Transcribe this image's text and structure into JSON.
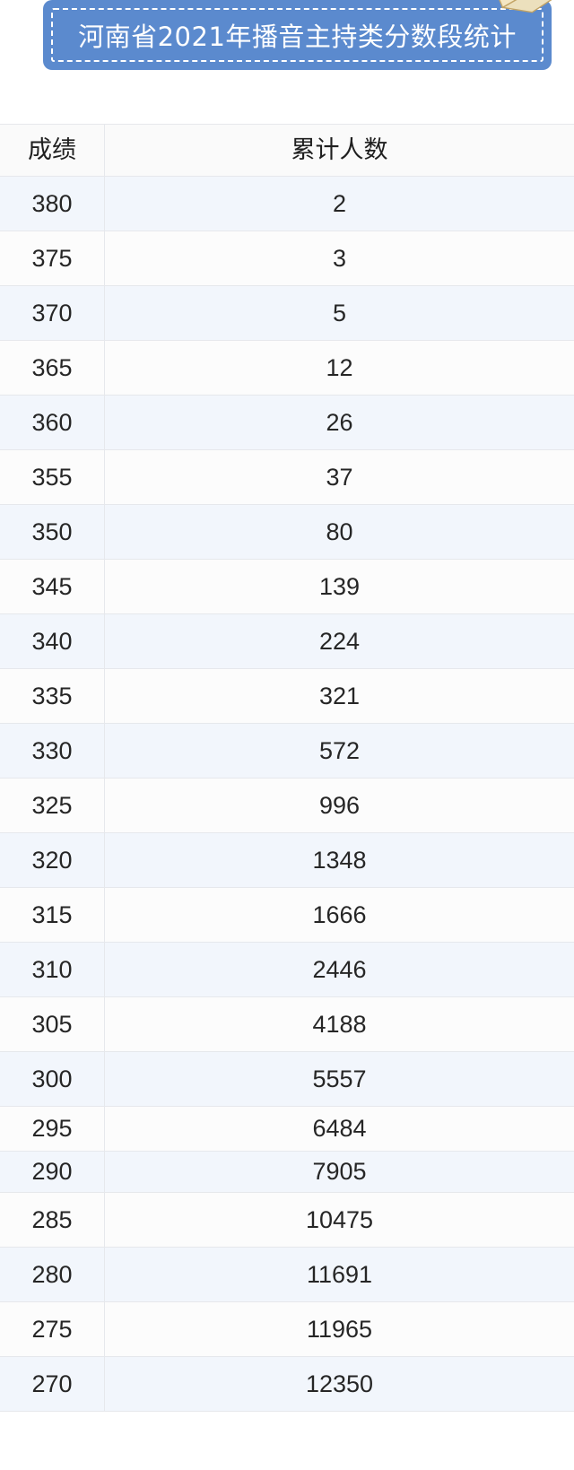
{
  "banner": {
    "title": "河南省2021年播音主持类分数段统计",
    "background_color": "#5b8ace",
    "text_color": "#ffffff",
    "border_style": "white-dashed",
    "decoration_icon": "open-book-icon"
  },
  "table": {
    "columns": [
      "成绩",
      "累计人数"
    ],
    "row_colors": {
      "odd": "#f2f6fc",
      "even": "#fcfcfc",
      "header": "#fafafa",
      "border": "#e6e8ec"
    },
    "rows": [
      {
        "score": "380",
        "count": "2"
      },
      {
        "score": "375",
        "count": "3"
      },
      {
        "score": "370",
        "count": "5"
      },
      {
        "score": "365",
        "count": "12"
      },
      {
        "score": "360",
        "count": "26"
      },
      {
        "score": "355",
        "count": "37"
      },
      {
        "score": "350",
        "count": "80"
      },
      {
        "score": "345",
        "count": "139"
      },
      {
        "score": "340",
        "count": "224"
      },
      {
        "score": "335",
        "count": "321"
      },
      {
        "score": "330",
        "count": "572"
      },
      {
        "score": "325",
        "count": "996"
      },
      {
        "score": "320",
        "count": "1348"
      },
      {
        "score": "315",
        "count": "1666"
      },
      {
        "score": "310",
        "count": "2446"
      },
      {
        "score": "305",
        "count": "4188"
      },
      {
        "score": "300",
        "count": "5557"
      },
      {
        "score": "295",
        "count": "6484"
      },
      {
        "score": "290",
        "count": "7905"
      },
      {
        "score": "285",
        "count": "10475"
      },
      {
        "score": "280",
        "count": "11691"
      },
      {
        "score": "275",
        "count": "11965"
      },
      {
        "score": "270",
        "count": "12350"
      }
    ]
  },
  "chart_data": {
    "type": "table",
    "title": "河南省2021年播音主持类分数段统计",
    "columns": [
      "成绩",
      "累计人数"
    ],
    "xlabel": "成绩",
    "ylabel": "累计人数",
    "categories": [
      "380",
      "375",
      "370",
      "365",
      "360",
      "355",
      "350",
      "345",
      "340",
      "335",
      "330",
      "325",
      "320",
      "315",
      "310",
      "305",
      "300",
      "295",
      "290",
      "285",
      "280",
      "275",
      "270"
    ],
    "values": [
      2,
      3,
      5,
      12,
      26,
      37,
      80,
      139,
      224,
      321,
      572,
      996,
      1348,
      1666,
      2446,
      4188,
      5557,
      6484,
      7905,
      10475,
      11691,
      11965,
      12350
    ],
    "series": [
      {
        "name": "累计人数",
        "values": [
          2,
          3,
          5,
          12,
          26,
          37,
          80,
          139,
          224,
          321,
          572,
          996,
          1348,
          1666,
          2446,
          4188,
          5557,
          6484,
          7905,
          10475,
          11691,
          11965,
          12350
        ]
      }
    ],
    "grid": true,
    "legend": "none"
  }
}
